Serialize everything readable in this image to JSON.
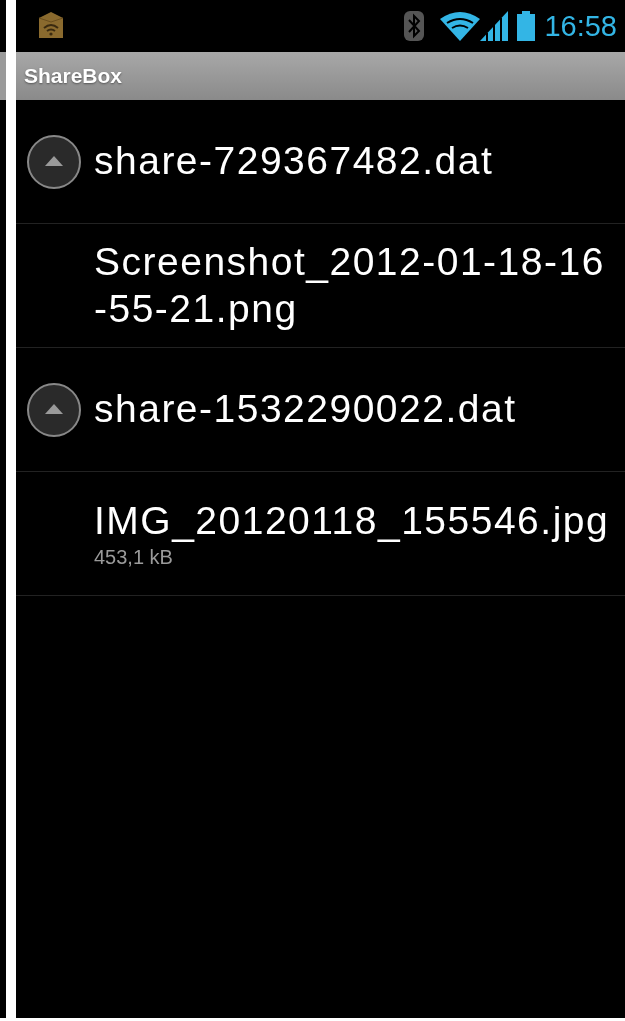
{
  "status_bar": {
    "time": "16:58"
  },
  "action_bar": {
    "title": "ShareBox"
  },
  "files": [
    {
      "name": "share-729367482.dat",
      "expanded": true,
      "children": [
        {
          "name": "Screenshot_2012-01-18-16\n-55-21.png"
        }
      ]
    },
    {
      "name": "share-1532290022.dat",
      "expanded": true,
      "children": [
        {
          "name": "IMG_20120118_155546.jpg",
          "size": "453,1 kB"
        }
      ]
    }
  ]
}
